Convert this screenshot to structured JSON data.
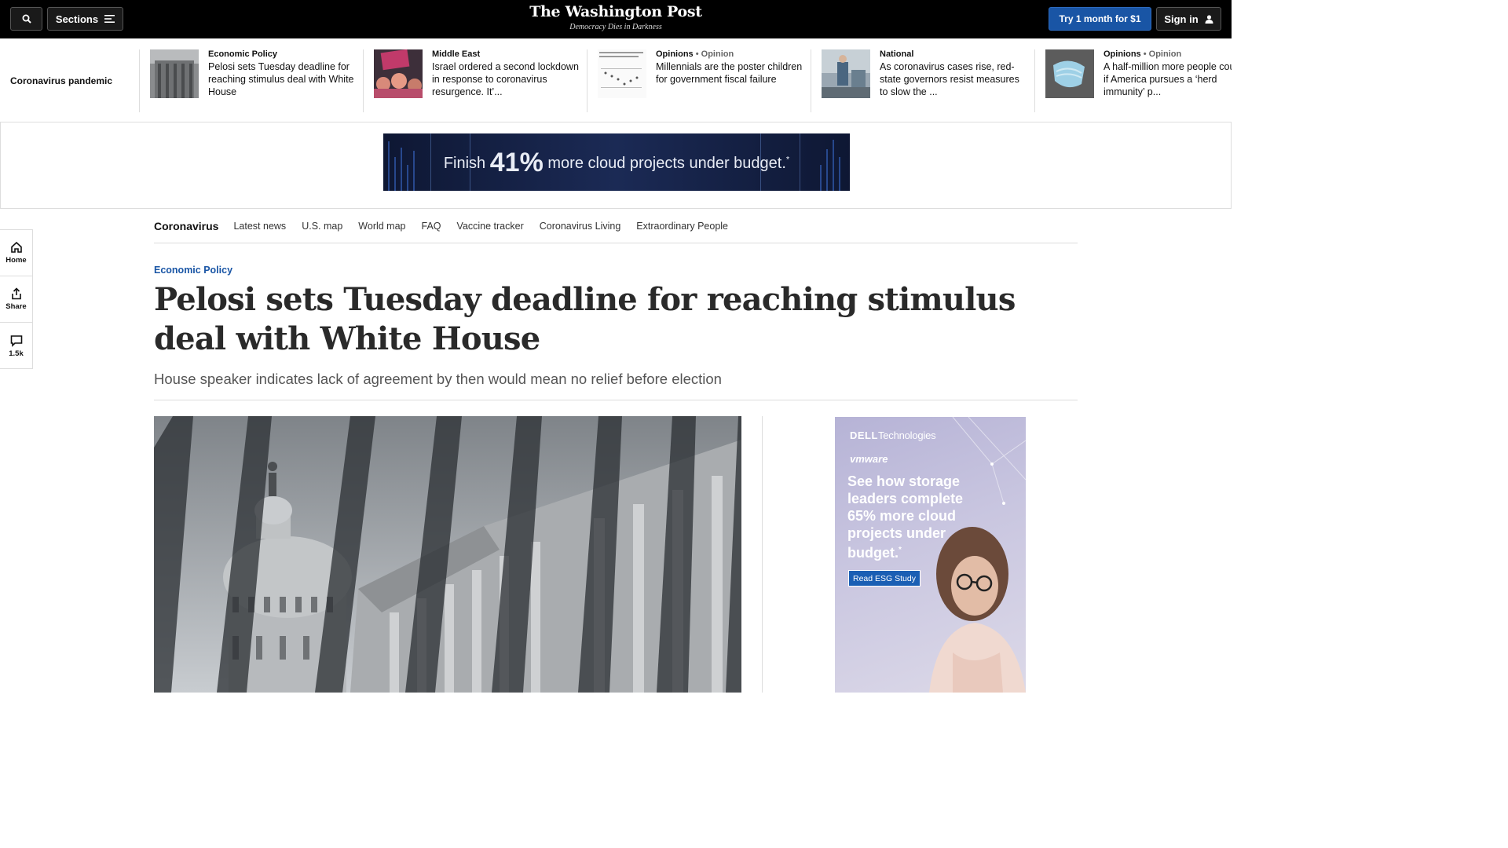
{
  "topbar": {
    "sections_label": "Sections",
    "logo": "The Washington Post",
    "tagline": "Democracy Dies in Darkness",
    "subscribe_label": "Try 1 month for $1",
    "signin_label": "Sign in",
    "accent": "#1955a5"
  },
  "strip": {
    "label": "Coronavirus pandemic",
    "items": [
      {
        "kicker": "Economic Policy",
        "opinion": "",
        "headline": "Pelosi sets Tuesday deadline for reaching stimulus deal with White House"
      },
      {
        "kicker": "Middle East",
        "opinion": "",
        "headline": "Israel ordered a second lockdown in response to coronavirus resurgence. It’..."
      },
      {
        "kicker": "Opinions",
        "opinion": "• Opinion",
        "headline": "Millennials are the poster children for government fiscal failure"
      },
      {
        "kicker": "National",
        "opinion": "",
        "headline": "As coronavirus cases rise, red-state governors resist measures to slow the ..."
      },
      {
        "kicker": "Opinions",
        "opinion": "• Opinion",
        "headline": "A half-million more people could die if America pursues a ‘herd immunity’ p..."
      }
    ]
  },
  "banner": {
    "pre": "Finish",
    "pct": "41%",
    "post": "more cloud projects under budget.",
    "mark": "*"
  },
  "secnav": {
    "brand": "Coronavirus",
    "links": [
      "Latest news",
      "U.S. map",
      "World map",
      "FAQ",
      "Vaccine tracker",
      "Coronavirus Living",
      "Extraordinary People"
    ]
  },
  "rail": {
    "home": "Home",
    "share": "Share",
    "comments": "1.5k"
  },
  "article": {
    "kicker": "Economic Policy",
    "headline": "Pelosi sets Tuesday deadline for reaching stimulus deal with White House",
    "dek": "House speaker indicates lack of agreement by then would mean no relief before election"
  },
  "sidead": {
    "brand_dell": "DELL",
    "brand_tech": "Technologies",
    "brand_vm": "vmware",
    "copy": "See how storage leaders complete 65% more cloud projects under budget.",
    "mark": "*",
    "cta": "Read ESG Study"
  }
}
